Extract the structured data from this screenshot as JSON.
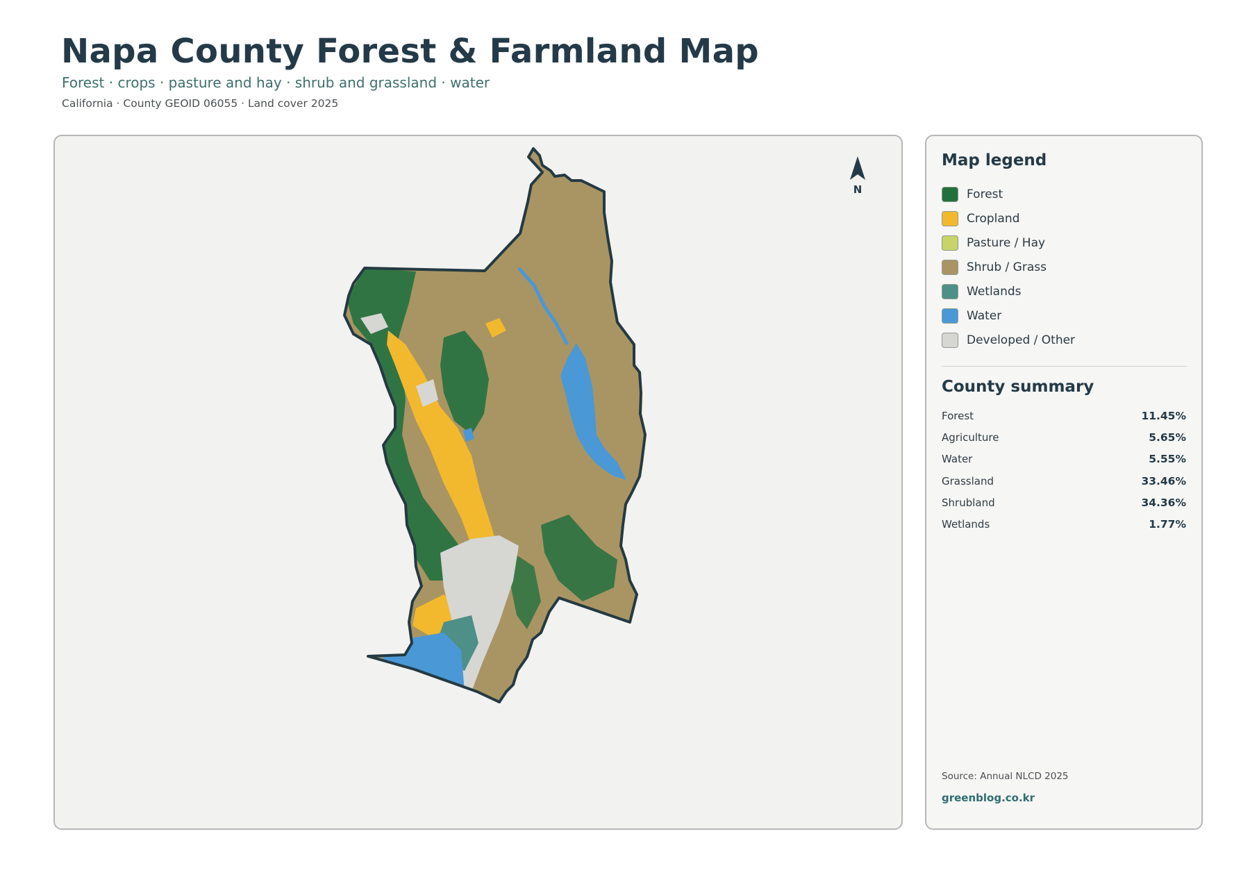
{
  "header": {
    "title": "Napa County Forest & Farmland Map",
    "subtitle": "Forest · crops · pasture and hay · shrub and grassland · water",
    "meta": "California · County GEOID 06055 · Land cover 2025"
  },
  "map": {
    "north_label": "N"
  },
  "legend": {
    "title": "Map legend",
    "items": [
      {
        "label": "Forest",
        "color": "#23703f"
      },
      {
        "label": "Cropland",
        "color": "#f2b92e"
      },
      {
        "label": "Pasture / Hay",
        "color": "#c6d46a"
      },
      {
        "label": "Shrub / Grass",
        "color": "#a99563"
      },
      {
        "label": "Wetlands",
        "color": "#4e8f88"
      },
      {
        "label": "Water",
        "color": "#4a98d6"
      },
      {
        "label": "Developed / Other",
        "color": "#d6d6d3"
      }
    ]
  },
  "summary": {
    "title": "County summary",
    "rows": [
      {
        "label": "Forest",
        "value": "11.45%"
      },
      {
        "label": "Agriculture",
        "value": "5.65%"
      },
      {
        "label": "Water",
        "value": "5.55%"
      },
      {
        "label": "Grassland",
        "value": "33.46%"
      },
      {
        "label": "Shrubland",
        "value": "34.36%"
      },
      {
        "label": "Wetlands",
        "value": "1.77%"
      }
    ]
  },
  "footer": {
    "source": "Source: Annual NLCD 2025",
    "site": "greenblog.co.kr"
  }
}
